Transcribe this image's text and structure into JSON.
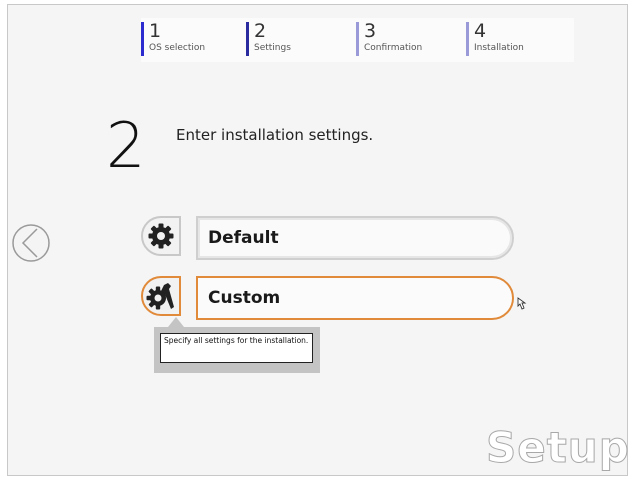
{
  "steps": [
    {
      "num": "1",
      "label": "OS selection"
    },
    {
      "num": "2",
      "label": "Settings"
    },
    {
      "num": "3",
      "label": "Confirmation"
    },
    {
      "num": "4",
      "label": "Installation"
    }
  ],
  "step_number": "2",
  "heading": "Enter installation settings.",
  "options": {
    "default_label": "Default",
    "custom_label": "Custom"
  },
  "tooltip": "Specify all settings for the installation.",
  "brand": "Setup",
  "colors": {
    "accent_orange": "#e08a3a",
    "step_bar": "#2b2bd0",
    "background": "#f5f5f5"
  },
  "icons": {
    "back": "circle-left-arrow-icon",
    "default": "gear-icon",
    "custom": "gear-wrench-icon",
    "cursor": "hand-pointer-icon"
  }
}
